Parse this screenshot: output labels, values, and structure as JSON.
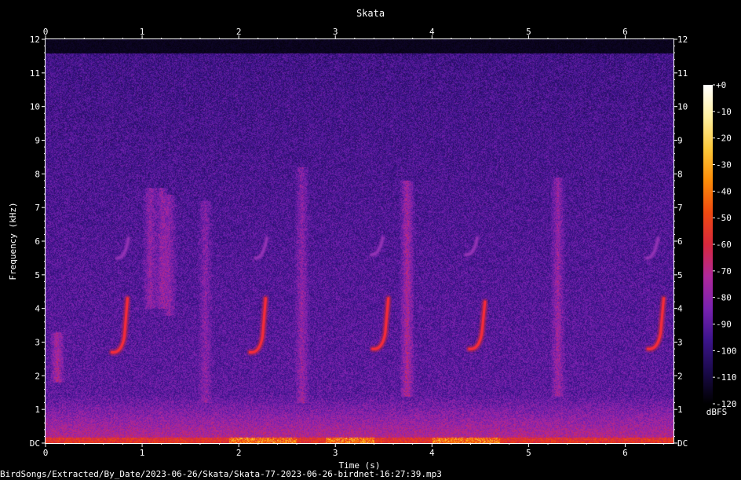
{
  "chart_data": {
    "type": "heatmap",
    "title": "Skata",
    "xlabel": "Time (s)",
    "ylabel": "Frequency (kHz)",
    "xlim": [
      0,
      6.5
    ],
    "ylim": [
      0,
      12
    ],
    "x_ticks": [
      "0",
      "1",
      "2",
      "3",
      "4",
      "5",
      "6"
    ],
    "x_tick_values": [
      0,
      1,
      2,
      3,
      4,
      5,
      6
    ],
    "y_ticks": [
      "DC",
      "1",
      "2",
      "3",
      "4",
      "5",
      "6",
      "7",
      "8",
      "9",
      "10",
      "11",
      "12"
    ],
    "y_tick_values": [
      0,
      1,
      2,
      3,
      4,
      5,
      6,
      7,
      8,
      9,
      10,
      11,
      12
    ],
    "colorbar": {
      "label": "dBFS",
      "ticks": [
        "+0",
        "-10",
        "-20",
        "-30",
        "-40",
        "-50",
        "-60",
        "-70",
        "-80",
        "-90",
        "-100",
        "-110",
        "-120"
      ],
      "tick_values": [
        0,
        -10,
        -20,
        -30,
        -40,
        -50,
        -60,
        -70,
        -80,
        -90,
        -100,
        -110,
        -120
      ],
      "range": [
        -120,
        0
      ],
      "colors": [
        "#000000",
        "#1a0a4a",
        "#3c148c",
        "#7a22b0",
        "#b0289a",
        "#d8283c",
        "#f04a10",
        "#fc8c08",
        "#fcc83a",
        "#fff0a0",
        "#ffffff"
      ]
    },
    "signal_cutoff_khz": 11.6,
    "calls": [
      {
        "t": 0.8,
        "low_khz": 2.7,
        "high_khz": 4.3,
        "upper_t": 0.82,
        "upper_low_khz": 5.5,
        "upper_high_khz": 6.1
      },
      {
        "t": 2.23,
        "low_khz": 2.7,
        "high_khz": 4.3,
        "upper_t": 2.25,
        "upper_low_khz": 5.5,
        "upper_high_khz": 6.1
      },
      {
        "t": 3.5,
        "low_khz": 2.8,
        "high_khz": 4.3,
        "upper_t": 3.45,
        "upper_low_khz": 5.6,
        "upper_high_khz": 6.1
      },
      {
        "t": 4.5,
        "low_khz": 2.8,
        "high_khz": 4.2,
        "upper_t": 4.43,
        "upper_low_khz": 5.6,
        "upper_high_khz": 6.1
      },
      {
        "t": 6.35,
        "low_khz": 2.8,
        "high_khz": 4.3,
        "upper_t": 6.3,
        "upper_low_khz": 5.5,
        "upper_high_khz": 6.1
      }
    ],
    "broadband_bursts": [
      {
        "t": 0.12,
        "low_khz": 1.8,
        "high_khz": 3.3,
        "strength": 0.9
      },
      {
        "t": 1.08,
        "low_khz": 4.0,
        "high_khz": 7.6,
        "strength": 0.7
      },
      {
        "t": 1.2,
        "low_khz": 4.0,
        "high_khz": 7.6,
        "strength": 0.7
      },
      {
        "t": 1.28,
        "low_khz": 3.8,
        "high_khz": 7.4,
        "strength": 0.6
      },
      {
        "t": 1.65,
        "low_khz": 1.2,
        "high_khz": 7.2,
        "strength": 0.55
      },
      {
        "t": 2.65,
        "low_khz": 1.2,
        "high_khz": 8.2,
        "strength": 0.65
      },
      {
        "t": 3.74,
        "low_khz": 1.4,
        "high_khz": 7.8,
        "strength": 0.95
      },
      {
        "t": 5.3,
        "low_khz": 1.4,
        "high_khz": 7.9,
        "strength": 0.75
      }
    ],
    "hot_floor_segments": [
      [
        1.9,
        2.6
      ],
      [
        2.9,
        3.4
      ],
      [
        4.0,
        4.7
      ]
    ]
  },
  "footer": {
    "file_path": "BirdSongs/Extracted/By_Date/2023-06-26/Skata/Skata-77-2023-06-26-birdnet-16:27:39.mp3"
  }
}
